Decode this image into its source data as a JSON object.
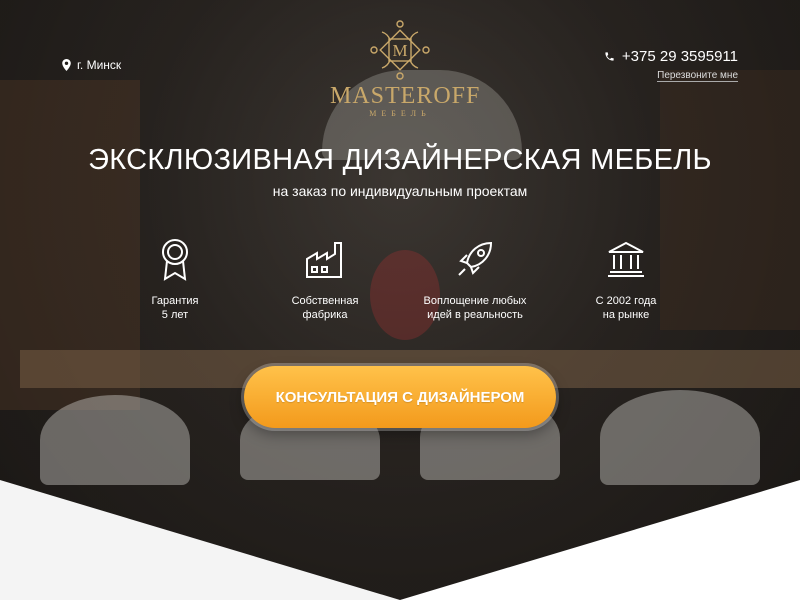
{
  "header": {
    "location": "г. Минск",
    "logo": {
      "name": "MASTEROFF",
      "subtitle": "МЕБЕЛЬ",
      "monogram": "M"
    },
    "phone": "+375 29 3595911",
    "callback_label": "Перезвоните мне"
  },
  "hero": {
    "title": "ЭКСКЛЮЗИВНАЯ ДИЗАЙНЕРСКАЯ МЕБЕЛЬ",
    "subtitle": "на заказ по индивидуальным проектам",
    "features": [
      {
        "icon": "award-ribbon-icon",
        "label": "Гарантия\n5 лет"
      },
      {
        "icon": "factory-icon",
        "label": "Собственная\nфабрика"
      },
      {
        "icon": "rocket-icon",
        "label": "Воплощение любых\nидей в реальность"
      },
      {
        "icon": "bank-building-icon",
        "label": "С 2002 года\nна рынке"
      }
    ],
    "cta_label": "КОНСУЛЬТАЦИЯ С ДИЗАЙНЕРОМ"
  },
  "colors": {
    "accent_gold": "#c9a86a",
    "cta_gradient_top": "#ffc24a",
    "cta_gradient_bottom": "#f39a1c",
    "text": "#ffffff"
  }
}
